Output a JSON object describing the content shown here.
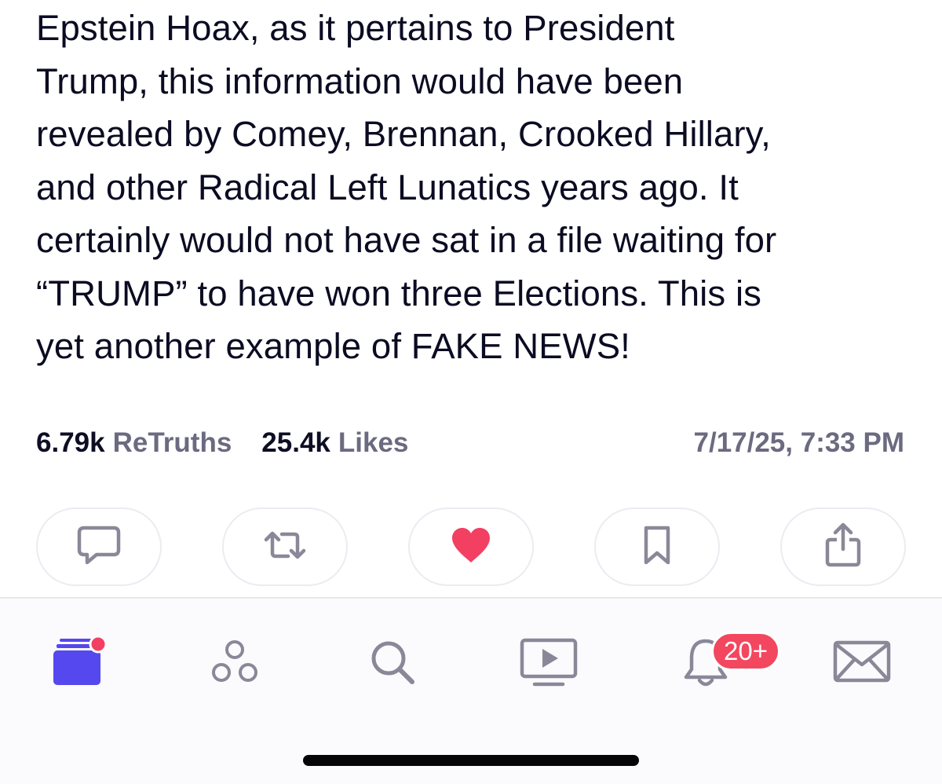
{
  "post": {
    "lines": [
      "Epstein Hoax, as it pertains to President",
      "Trump, this information would have been",
      "revealed by Comey, Brennan, Crooked Hillary,",
      "and other Radical Left Lunatics years ago. It",
      "certainly would not have sat in a file waiting for",
      "“TRUMP” to have won three Elections. This is",
      "yet another example of FAKE NEWS!"
    ]
  },
  "stats": {
    "retruths_count": "6.79k",
    "retruths_label": "ReTruths",
    "likes_count": "25.4k",
    "likes_label": "Likes",
    "timestamp": "7/17/25, 7:33 PM"
  },
  "actions": [
    {
      "name": "reply",
      "icon": "speech-bubble-icon"
    },
    {
      "name": "retruth",
      "icon": "repost-arrows-icon"
    },
    {
      "name": "like",
      "icon": "heart-icon",
      "active": true
    },
    {
      "name": "bookmark",
      "icon": "bookmark-icon"
    },
    {
      "name": "share",
      "icon": "share-icon"
    }
  ],
  "tabbar": {
    "tabs": [
      "home",
      "groups",
      "search",
      "video",
      "notifications",
      "messages"
    ],
    "notifications_badge": "20+"
  },
  "colors": {
    "text": "#0b0b22",
    "muted": "#6b6a80",
    "accent": "#5448ee",
    "heart": "#f23f62",
    "badge": "#f2475f",
    "icon_gray": "#8a8898"
  }
}
